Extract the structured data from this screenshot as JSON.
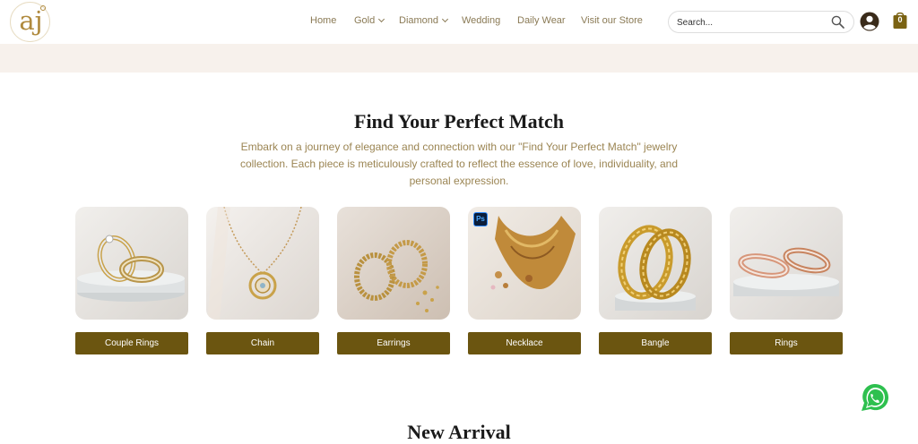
{
  "logo": {
    "text": "aj"
  },
  "nav": {
    "items": [
      {
        "label": "Home"
      },
      {
        "label": "Gold"
      },
      {
        "label": "Diamond"
      },
      {
        "label": "Wedding"
      },
      {
        "label": "Daily Wear"
      },
      {
        "label": "Visit our Store"
      }
    ]
  },
  "search": {
    "placeholder": "Search..."
  },
  "cart": {
    "count": "0"
  },
  "section": {
    "title": "Find Your Perfect Match",
    "description": "Embark on a journey of elegance and connection with our \"Find Your Perfect Match\" jewelry collection. Each piece is meticulously crafted to reflect the essence of love, individuality, and personal expression."
  },
  "categories": [
    {
      "label": "Couple Rings"
    },
    {
      "label": "Chain"
    },
    {
      "label": "Earrings"
    },
    {
      "label": "Necklace"
    },
    {
      "label": "Bangle"
    },
    {
      "label": "Rings"
    }
  ],
  "badge": {
    "ps": "Ps"
  },
  "new_arrival": {
    "title": "New Arrival"
  },
  "colors": {
    "accent": "#6b5510",
    "gold_text": "#9b8553",
    "banner": "#f7f1ec"
  }
}
